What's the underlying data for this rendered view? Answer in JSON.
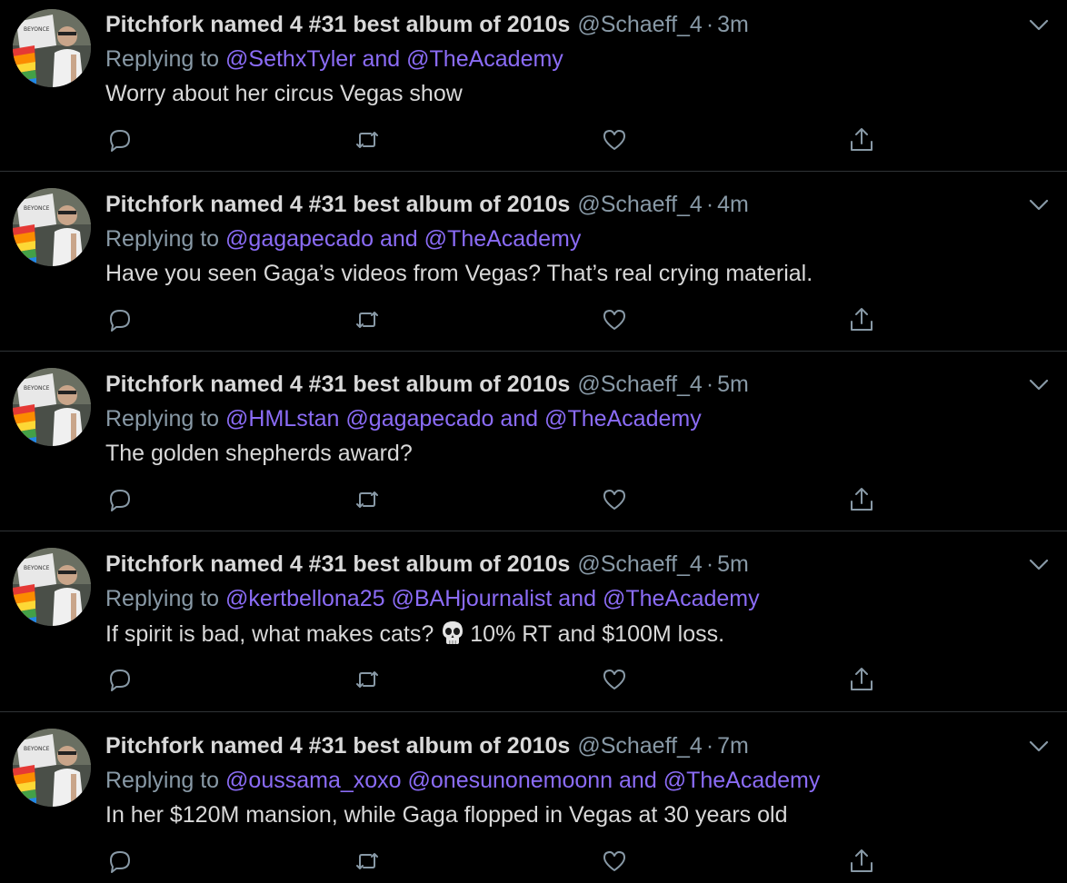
{
  "colors": {
    "background": "#000000",
    "text": "#d9d9d9",
    "muted": "#8899a6",
    "mention": "#8b6cf6",
    "divider": "#2f3336"
  },
  "icons": {
    "reply": "speech-bubble-icon",
    "retweet": "retweet-arrows-icon",
    "like": "heart-outline-icon",
    "share": "share-upload-icon",
    "menu": "chevron-down-icon",
    "skull": "skull-emoji"
  },
  "tweets": [
    {
      "name": "Pitchfork named 4 #31 best album of 2010s",
      "handle": "@Schaeff_4",
      "dot": "·",
      "time": "3m",
      "replying_prefix": "Replying to",
      "mentions": [
        "@SethxTyler",
        "and",
        "@TheAcademy"
      ],
      "text": "Worry about her circus Vegas show"
    },
    {
      "name": "Pitchfork named 4 #31 best album of 2010s",
      "handle": "@Schaeff_4",
      "dot": "·",
      "time": "4m",
      "replying_prefix": "Replying to",
      "mentions": [
        "@gagapecado",
        "and",
        "@TheAcademy"
      ],
      "text": "Have you seen Gaga’s videos from Vegas? That’s real crying material."
    },
    {
      "name": "Pitchfork named 4 #31 best album of 2010s",
      "handle": "@Schaeff_4",
      "dot": "·",
      "time": "5m",
      "replying_prefix": "Replying to",
      "mentions": [
        "@HMLstan",
        "@gagapecado",
        "and",
        "@TheAcademy"
      ],
      "text": "The golden shepherds award?"
    },
    {
      "name": "Pitchfork named 4 #31 best album of 2010s",
      "handle": "@Schaeff_4",
      "dot": "·",
      "time": "5m",
      "replying_prefix": "Replying to",
      "mentions": [
        "@kertbellona25",
        "@BAHjournalist",
        "and",
        "@TheAcademy"
      ],
      "text_before": "If spirit is bad, what makes cats?",
      "text_after": "10% RT and $100M loss."
    },
    {
      "name": "Pitchfork named 4 #31 best album of 2010s",
      "handle": "@Schaeff_4",
      "dot": "·",
      "time": "7m",
      "replying_prefix": "Replying to",
      "mentions": [
        "@oussama_xoxo",
        "@onesunonemoonn",
        "and",
        "@TheAcademy"
      ],
      "text": "In her $120M mansion, while Gaga flopped in Vegas at 30 years old"
    }
  ]
}
